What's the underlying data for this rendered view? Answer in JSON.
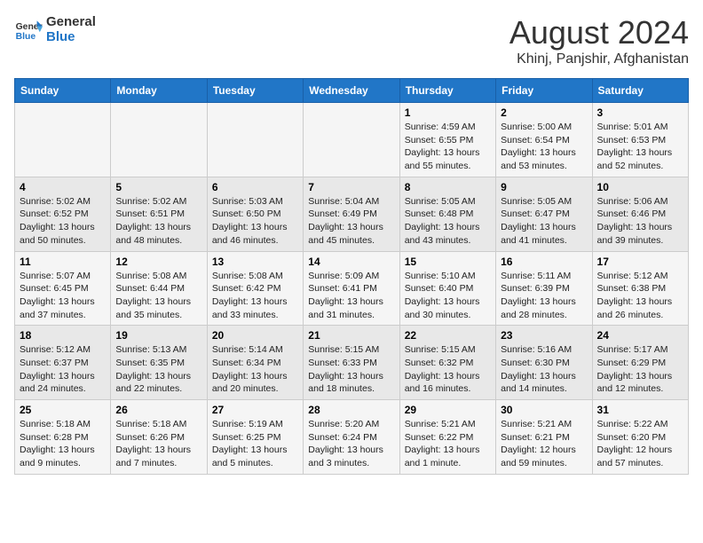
{
  "header": {
    "logo_line1": "General",
    "logo_line2": "Blue",
    "main_title": "August 2024",
    "subtitle": "Khinj, Panjshir, Afghanistan"
  },
  "days_of_week": [
    "Sunday",
    "Monday",
    "Tuesday",
    "Wednesday",
    "Thursday",
    "Friday",
    "Saturday"
  ],
  "weeks": [
    [
      {
        "day": "",
        "info": ""
      },
      {
        "day": "",
        "info": ""
      },
      {
        "day": "",
        "info": ""
      },
      {
        "day": "",
        "info": ""
      },
      {
        "day": "1",
        "info": "Sunrise: 4:59 AM\nSunset: 6:55 PM\nDaylight: 13 hours\nand 55 minutes."
      },
      {
        "day": "2",
        "info": "Sunrise: 5:00 AM\nSunset: 6:54 PM\nDaylight: 13 hours\nand 53 minutes."
      },
      {
        "day": "3",
        "info": "Sunrise: 5:01 AM\nSunset: 6:53 PM\nDaylight: 13 hours\nand 52 minutes."
      }
    ],
    [
      {
        "day": "4",
        "info": "Sunrise: 5:02 AM\nSunset: 6:52 PM\nDaylight: 13 hours\nand 50 minutes."
      },
      {
        "day": "5",
        "info": "Sunrise: 5:02 AM\nSunset: 6:51 PM\nDaylight: 13 hours\nand 48 minutes."
      },
      {
        "day": "6",
        "info": "Sunrise: 5:03 AM\nSunset: 6:50 PM\nDaylight: 13 hours\nand 46 minutes."
      },
      {
        "day": "7",
        "info": "Sunrise: 5:04 AM\nSunset: 6:49 PM\nDaylight: 13 hours\nand 45 minutes."
      },
      {
        "day": "8",
        "info": "Sunrise: 5:05 AM\nSunset: 6:48 PM\nDaylight: 13 hours\nand 43 minutes."
      },
      {
        "day": "9",
        "info": "Sunrise: 5:05 AM\nSunset: 6:47 PM\nDaylight: 13 hours\nand 41 minutes."
      },
      {
        "day": "10",
        "info": "Sunrise: 5:06 AM\nSunset: 6:46 PM\nDaylight: 13 hours\nand 39 minutes."
      }
    ],
    [
      {
        "day": "11",
        "info": "Sunrise: 5:07 AM\nSunset: 6:45 PM\nDaylight: 13 hours\nand 37 minutes."
      },
      {
        "day": "12",
        "info": "Sunrise: 5:08 AM\nSunset: 6:44 PM\nDaylight: 13 hours\nand 35 minutes."
      },
      {
        "day": "13",
        "info": "Sunrise: 5:08 AM\nSunset: 6:42 PM\nDaylight: 13 hours\nand 33 minutes."
      },
      {
        "day": "14",
        "info": "Sunrise: 5:09 AM\nSunset: 6:41 PM\nDaylight: 13 hours\nand 31 minutes."
      },
      {
        "day": "15",
        "info": "Sunrise: 5:10 AM\nSunset: 6:40 PM\nDaylight: 13 hours\nand 30 minutes."
      },
      {
        "day": "16",
        "info": "Sunrise: 5:11 AM\nSunset: 6:39 PM\nDaylight: 13 hours\nand 28 minutes."
      },
      {
        "day": "17",
        "info": "Sunrise: 5:12 AM\nSunset: 6:38 PM\nDaylight: 13 hours\nand 26 minutes."
      }
    ],
    [
      {
        "day": "18",
        "info": "Sunrise: 5:12 AM\nSunset: 6:37 PM\nDaylight: 13 hours\nand 24 minutes."
      },
      {
        "day": "19",
        "info": "Sunrise: 5:13 AM\nSunset: 6:35 PM\nDaylight: 13 hours\nand 22 minutes."
      },
      {
        "day": "20",
        "info": "Sunrise: 5:14 AM\nSunset: 6:34 PM\nDaylight: 13 hours\nand 20 minutes."
      },
      {
        "day": "21",
        "info": "Sunrise: 5:15 AM\nSunset: 6:33 PM\nDaylight: 13 hours\nand 18 minutes."
      },
      {
        "day": "22",
        "info": "Sunrise: 5:15 AM\nSunset: 6:32 PM\nDaylight: 13 hours\nand 16 minutes."
      },
      {
        "day": "23",
        "info": "Sunrise: 5:16 AM\nSunset: 6:30 PM\nDaylight: 13 hours\nand 14 minutes."
      },
      {
        "day": "24",
        "info": "Sunrise: 5:17 AM\nSunset: 6:29 PM\nDaylight: 13 hours\nand 12 minutes."
      }
    ],
    [
      {
        "day": "25",
        "info": "Sunrise: 5:18 AM\nSunset: 6:28 PM\nDaylight: 13 hours\nand 9 minutes."
      },
      {
        "day": "26",
        "info": "Sunrise: 5:18 AM\nSunset: 6:26 PM\nDaylight: 13 hours\nand 7 minutes."
      },
      {
        "day": "27",
        "info": "Sunrise: 5:19 AM\nSunset: 6:25 PM\nDaylight: 13 hours\nand 5 minutes."
      },
      {
        "day": "28",
        "info": "Sunrise: 5:20 AM\nSunset: 6:24 PM\nDaylight: 13 hours\nand 3 minutes."
      },
      {
        "day": "29",
        "info": "Sunrise: 5:21 AM\nSunset: 6:22 PM\nDaylight: 13 hours\nand 1 minute."
      },
      {
        "day": "30",
        "info": "Sunrise: 5:21 AM\nSunset: 6:21 PM\nDaylight: 12 hours\nand 59 minutes."
      },
      {
        "day": "31",
        "info": "Sunrise: 5:22 AM\nSunset: 6:20 PM\nDaylight: 12 hours\nand 57 minutes."
      }
    ]
  ]
}
